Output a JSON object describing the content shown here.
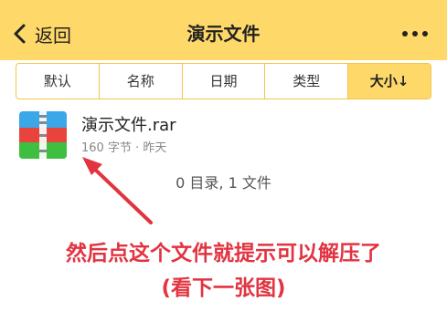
{
  "header": {
    "title": "演示文件",
    "back_label": "返回"
  },
  "sort_tabs": [
    {
      "label": "默认"
    },
    {
      "label": "名称"
    },
    {
      "label": "日期"
    },
    {
      "label": "类型"
    },
    {
      "label": "大小↓",
      "active": true
    }
  ],
  "file": {
    "name": "演示文件.rar",
    "meta": "160 字节 · 昨天"
  },
  "summary": "0 目录, 1 文件",
  "annotation": {
    "line1": "然后点这个文件就提示可以解压了",
    "line2": "(看下一张图)"
  },
  "colors": {
    "header_bg": "#ffd86a",
    "active_tab_bg": "#ffd86a",
    "annotation_text": "#e23340",
    "rar_stripe_top": "#3aa7e8",
    "rar_stripe_mid": "#e8433c",
    "rar_stripe_bottom": "#3fbf3f"
  },
  "icons": {
    "back": "chevron-left-icon",
    "more": "more-dots-icon",
    "file": "rar-archive-icon"
  }
}
